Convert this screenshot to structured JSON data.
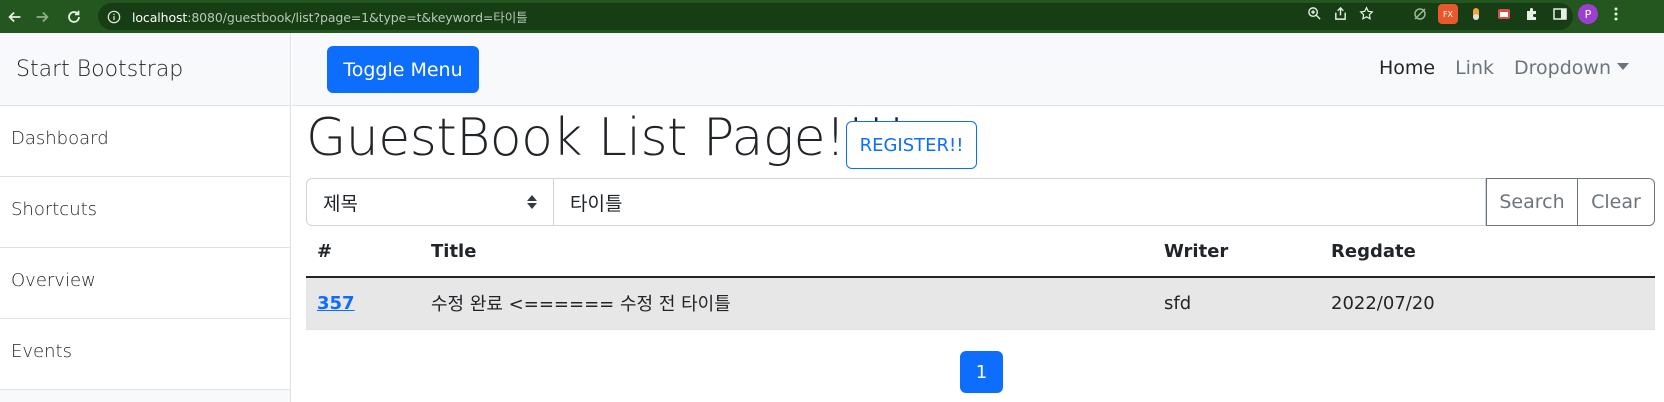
{
  "browser": {
    "url_host": "localhost",
    "url_rest": ":8080/guestbook/list?page=1&type=t&keyword=타이틀",
    "profile_initial": "P",
    "ext_label": "FX"
  },
  "sidebar": {
    "heading": "Start Bootstrap",
    "items": [
      {
        "label": "Dashboard"
      },
      {
        "label": "Shortcuts"
      },
      {
        "label": "Overview"
      },
      {
        "label": "Events"
      }
    ]
  },
  "topnav": {
    "toggle_label": "Toggle Menu",
    "links": {
      "home": "Home",
      "link": "Link",
      "dropdown": "Dropdown"
    }
  },
  "main": {
    "title": "GuestBook List Page!!!!",
    "register_label": "REGISTER!!",
    "search": {
      "type_selected": "제목",
      "keyword_value": "타이틀",
      "search_label": "Search",
      "clear_label": "Clear"
    },
    "table": {
      "headers": [
        "#",
        "Title",
        "Writer",
        "Regdate"
      ],
      "rows": [
        {
          "no": "357",
          "title": "수정 완료 <====== 수정 전 타이틀",
          "writer": "sfd",
          "regdate": "2022/07/20"
        }
      ]
    },
    "pagination": {
      "current": "1"
    }
  },
  "colors": {
    "primary": "#0d6efd",
    "browser_frame": "#24561f",
    "row_highlight": "#e7e7e7"
  }
}
